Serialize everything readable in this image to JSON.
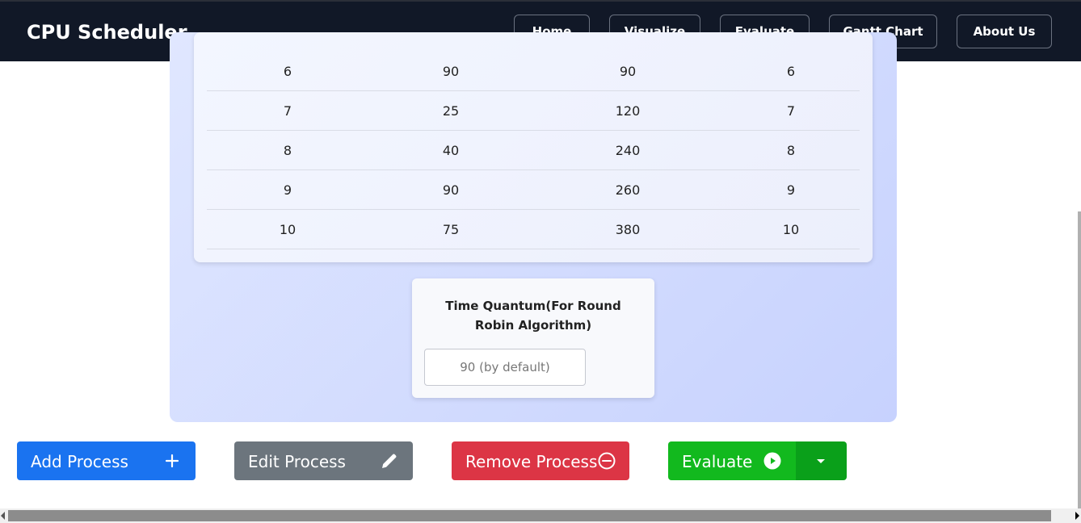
{
  "brand": "CPU Scheduler",
  "nav": [
    "Home",
    "Visualize",
    "Evaluate",
    "Gantt Chart",
    "About Us"
  ],
  "table": {
    "rows": [
      [
        "6",
        "90",
        "90",
        "6"
      ],
      [
        "7",
        "25",
        "120",
        "7"
      ],
      [
        "8",
        "40",
        "240",
        "8"
      ],
      [
        "9",
        "90",
        "260",
        "9"
      ],
      [
        "10",
        "75",
        "380",
        "10"
      ]
    ]
  },
  "time_quantum": {
    "label": "Time Quantum(For Round Robin Algorithm)",
    "placeholder": "90 (by default)"
  },
  "actions": {
    "add": "Add Process",
    "edit": "Edit Process",
    "remove": "Remove Process",
    "evaluate": "Evaluate"
  },
  "colors": {
    "navbar": "#111827",
    "add": "#1a73f0",
    "edit": "#6c757d",
    "remove": "#dc3545",
    "evaluate": "#12b91e",
    "evaluate_dropdown": "#0aa01a"
  },
  "icons": {
    "add": "plus-icon",
    "edit": "pencil-icon",
    "remove": "minus-circle-icon",
    "evaluate": "play-circle-icon",
    "evaluate_dropdown": "caret-down-icon"
  }
}
